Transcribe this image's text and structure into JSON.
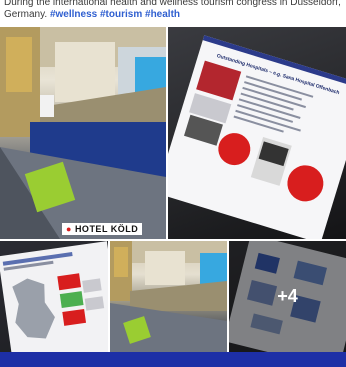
{
  "post": {
    "caption_line1": "During the international health and wellness tourism congress in Düsseldorf,",
    "caption_line2": "Germany.",
    "hashtags": [
      "#wellness",
      "#tourism",
      "#health"
    ]
  },
  "photos": {
    "hall_sign_text": "HOTEL KÖLD",
    "slide_title": "Outstanding Hospitals – e.g. Sana Hospital Offenbach",
    "more_count": "+4"
  },
  "colors": {
    "page_bg": "#1d2fa6",
    "hashtag": "#2f5fd0",
    "slide_red": "#d81e1e"
  }
}
